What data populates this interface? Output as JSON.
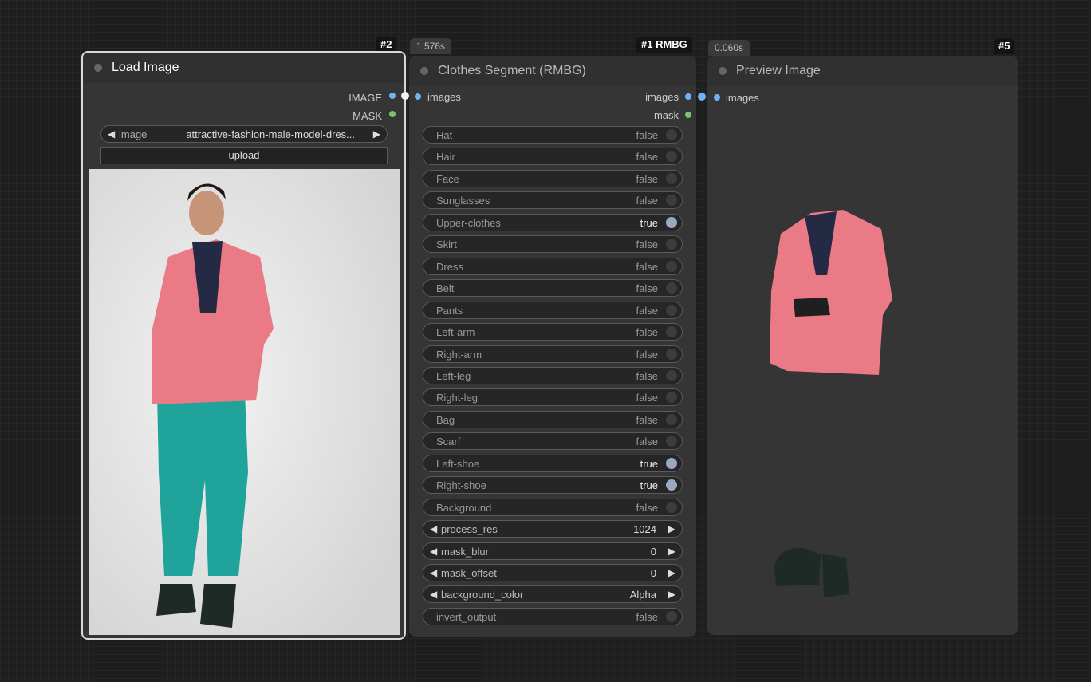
{
  "nodes": {
    "load_image": {
      "title": "Load Image",
      "badge": "#2",
      "outputs": [
        "IMAGE",
        "MASK"
      ],
      "image_widget": {
        "label": "image",
        "value": "attractive-fashion-male-model-dres..."
      },
      "upload_label": "upload"
    },
    "clothes_segment": {
      "title": "Clothes Segment (RMBG)",
      "badge": "#1 RMBG",
      "timing": "1.576s",
      "input": "images",
      "outputs": [
        "images",
        "mask"
      ],
      "toggles": [
        {
          "label": "Hat",
          "value": "false"
        },
        {
          "label": "Hair",
          "value": "false"
        },
        {
          "label": "Face",
          "value": "false"
        },
        {
          "label": "Sunglasses",
          "value": "false"
        },
        {
          "label": "Upper-clothes",
          "value": "true"
        },
        {
          "label": "Skirt",
          "value": "false"
        },
        {
          "label": "Dress",
          "value": "false"
        },
        {
          "label": "Belt",
          "value": "false"
        },
        {
          "label": "Pants",
          "value": "false"
        },
        {
          "label": "Left-arm",
          "value": "false"
        },
        {
          "label": "Right-arm",
          "value": "false"
        },
        {
          "label": "Left-leg",
          "value": "false"
        },
        {
          "label": "Right-leg",
          "value": "false"
        },
        {
          "label": "Bag",
          "value": "false"
        },
        {
          "label": "Scarf",
          "value": "false"
        },
        {
          "label": "Left-shoe",
          "value": "true"
        },
        {
          "label": "Right-shoe",
          "value": "true"
        },
        {
          "label": "Background",
          "value": "false"
        }
      ],
      "combos": [
        {
          "label": "process_res",
          "value": "1024"
        },
        {
          "label": "mask_blur",
          "value": "0"
        },
        {
          "label": "mask_offset",
          "value": "0"
        },
        {
          "label": "background_color",
          "value": "Alpha"
        }
      ],
      "invert": {
        "label": "invert_output",
        "value": "false"
      }
    },
    "preview_image": {
      "title": "Preview Image",
      "badge": "#5",
      "timing": "0.060s",
      "input": "images"
    }
  },
  "colors": {
    "jacket": "#ea7a86",
    "pants": "#1fa39a",
    "shirt": "#252a44",
    "shoes": "#1e2a26",
    "skin": "#c89478",
    "hair": "#1f1a18"
  }
}
